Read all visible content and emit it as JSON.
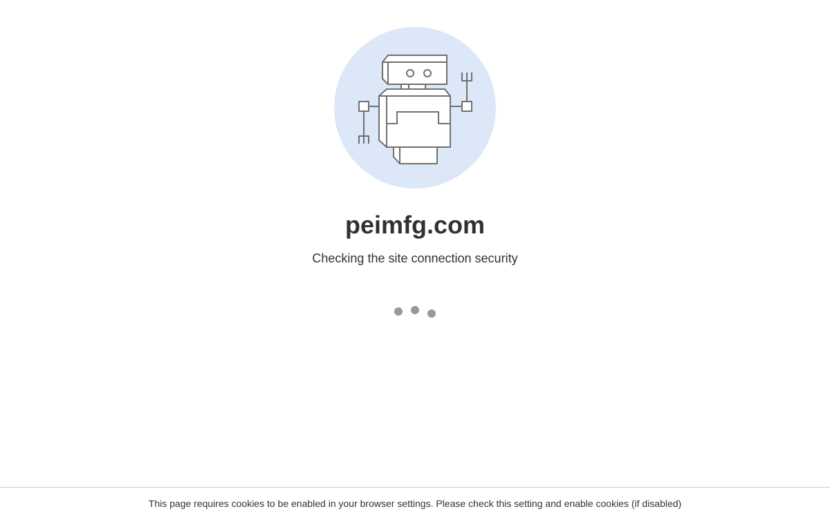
{
  "site": {
    "domain": "peimfg.com",
    "status_text": "Checking the site connection security"
  },
  "loader": {
    "dot_count": 3
  },
  "footer": {
    "cookie_notice": "This page requires cookies to be enabled in your browser settings. Please check this setting and enable cookies (if disabled)"
  },
  "colors": {
    "background": "#ffffff",
    "circle": "#dce8f7",
    "text": "#313131",
    "robot_stroke": "#6f6f6f",
    "dots": "#999999"
  },
  "icons": {
    "illustration": "robot-icon"
  }
}
